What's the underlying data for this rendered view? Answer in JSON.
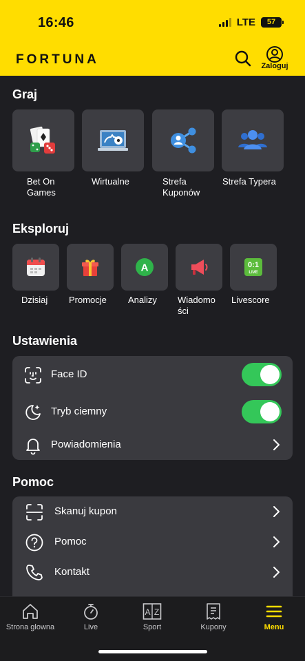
{
  "status": {
    "time": "16:46",
    "network": "LTE",
    "battery": "57"
  },
  "header": {
    "logo": "FORTUNA",
    "login_label": "Zaloguj"
  },
  "graj": {
    "title": "Graj",
    "tiles": [
      {
        "label": "Bet On Games",
        "icon": "cards-dice-icon"
      },
      {
        "label": "Wirtualne",
        "icon": "virtual-laptop-icon"
      },
      {
        "label": "Strefa Kuponów",
        "icon": "share-network-icon"
      },
      {
        "label": "Strefa Typera",
        "icon": "group-icon"
      }
    ]
  },
  "eksploruj": {
    "title": "Eksploruj",
    "tiles": [
      {
        "label": "Dzisiaj",
        "icon": "calendar-icon"
      },
      {
        "label": "Promocje",
        "icon": "gift-icon"
      },
      {
        "label": "Analizy",
        "icon": "analysis-a-icon",
        "glyph": "A"
      },
      {
        "label": "Wiadomo ści",
        "icon": "megaphone-icon"
      },
      {
        "label": "Livescore",
        "icon": "livescore-icon",
        "glyph": "0:1",
        "glyph2": "LIVE"
      }
    ]
  },
  "ustawienia": {
    "title": "Ustawienia",
    "rows": [
      {
        "label": "Face ID",
        "icon": "face-id-icon",
        "toggle_on": true
      },
      {
        "label": "Tryb ciemny",
        "icon": "dark-mode-icon",
        "toggle_on": true
      },
      {
        "label": "Powiadomienia",
        "icon": "bell-icon"
      }
    ]
  },
  "pomoc": {
    "title": "Pomoc",
    "rows": [
      {
        "label": "Skanuj kupon",
        "icon": "scan-icon"
      },
      {
        "label": "Pomoc",
        "icon": "help-icon"
      },
      {
        "label": "Kontakt",
        "icon": "phone-icon"
      }
    ]
  },
  "tabbar": {
    "tabs": [
      {
        "label": "Strona glowna",
        "icon": "home-icon"
      },
      {
        "label": "Live",
        "icon": "stopwatch-icon"
      },
      {
        "label": "Sport",
        "icon": "sport-icon"
      },
      {
        "label": "Kupony",
        "icon": "coupon-icon"
      },
      {
        "label": "Menu",
        "icon": "menu-icon",
        "active": true
      }
    ]
  },
  "colors": {
    "brand_yellow": "#ffdd00",
    "background": "#1e1e22",
    "card": "#3a3a3f",
    "toggle_on": "#34c759"
  }
}
